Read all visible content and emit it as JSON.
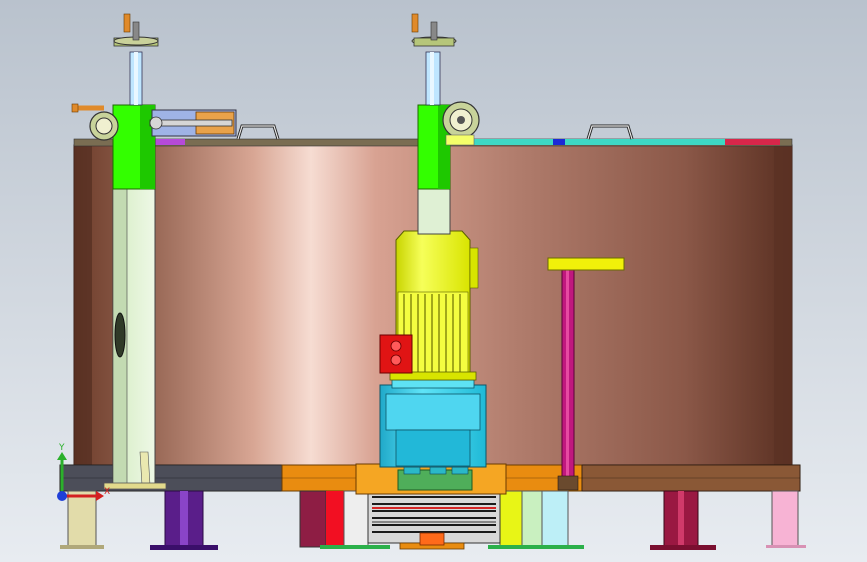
{
  "viewport": {
    "background_top": "#b9c2cd",
    "background_bottom": "#e8ecf1"
  },
  "triad": {
    "x_axis_label": "X",
    "y_axis_label": "Y",
    "x_color": "#d42020",
    "y_color": "#2bb02b",
    "z_color": "#1f3fd8"
  },
  "colors": {
    "tank_copper": "#b98a7c",
    "support_column": "#30ff00",
    "motor_yellow": "#f2ff1a",
    "gearbox_cyan": "#2fd3ee",
    "junction_box_red": "#e01414",
    "handle_magenta": "#c0187e",
    "handle_yellow": "#f1f10a",
    "base_orange": "#e98c10",
    "base_brown": "#6b4a2a"
  }
}
